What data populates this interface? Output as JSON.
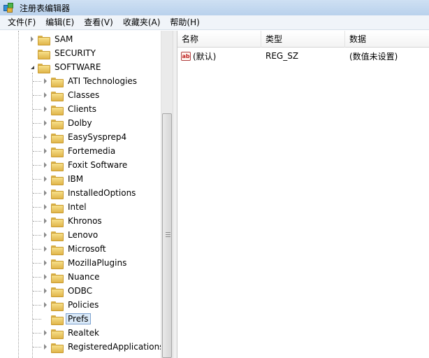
{
  "window": {
    "title": "注册表编辑器"
  },
  "menu": [
    "文件(F)",
    "编辑(E)",
    "查看(V)",
    "收藏夹(A)",
    "帮助(H)"
  ],
  "tree": {
    "top_items": [
      {
        "label": "SAM",
        "state": "collapsed"
      },
      {
        "label": "SECURITY",
        "state": "none"
      },
      {
        "label": "SOFTWARE",
        "state": "expanded"
      }
    ],
    "software_children": [
      "ATI Technologies",
      "Classes",
      "Clients",
      "Dolby",
      "EasySysprep4",
      "Fortemedia",
      "Foxit Software",
      "IBM",
      "InstalledOptions",
      "Intel",
      "Khronos",
      "Lenovo",
      "Microsoft",
      "MozillaPlugins",
      "Nuance",
      "ODBC",
      "Policies",
      "Prefs",
      "Realtek",
      "RegisteredApplications"
    ],
    "selected": "Prefs"
  },
  "list": {
    "columns": [
      "名称",
      "类型",
      "数据"
    ],
    "rows": [
      {
        "name": "(默认)",
        "type": "REG_SZ",
        "data": "(数值未设置)",
        "icon": "ab-string-icon"
      }
    ]
  }
}
